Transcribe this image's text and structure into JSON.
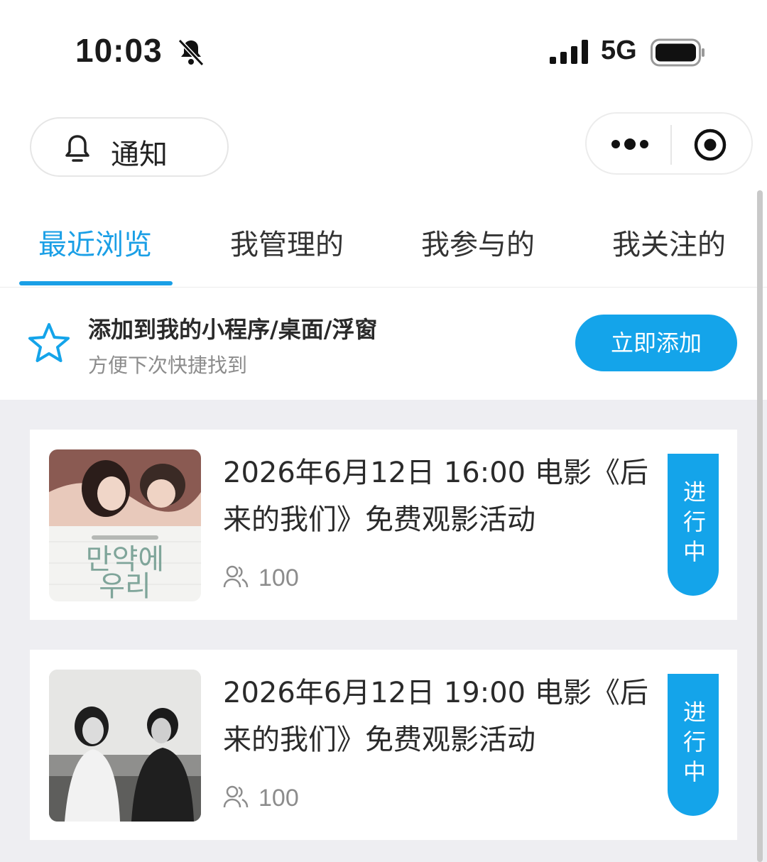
{
  "status_bar": {
    "time": "10:03",
    "network": "5G"
  },
  "header": {
    "notice_label": "通知"
  },
  "tabs": [
    {
      "label": "最近浏览",
      "active": true
    },
    {
      "label": "我管理的",
      "active": false
    },
    {
      "label": "我参与的",
      "active": false
    },
    {
      "label": "我关注的",
      "active": false
    }
  ],
  "banner": {
    "title": "添加到我的小程序/桌面/浮窗",
    "subtitle": "方便下次快捷找到",
    "button_label": "立即添加"
  },
  "events": [
    {
      "title": "2026年6月12日 16:00 电影《后来的我们》免费观影活动",
      "count": "100",
      "status": "进行中",
      "poster_text": "만약에 우리"
    },
    {
      "title": "2026年6月12日 19:00 电影《后来的我们》免费观影活动",
      "count": "100",
      "status": "进行中"
    }
  ],
  "colors": {
    "accent": "#14a4ea",
    "list_bg": "#eeeef2"
  }
}
